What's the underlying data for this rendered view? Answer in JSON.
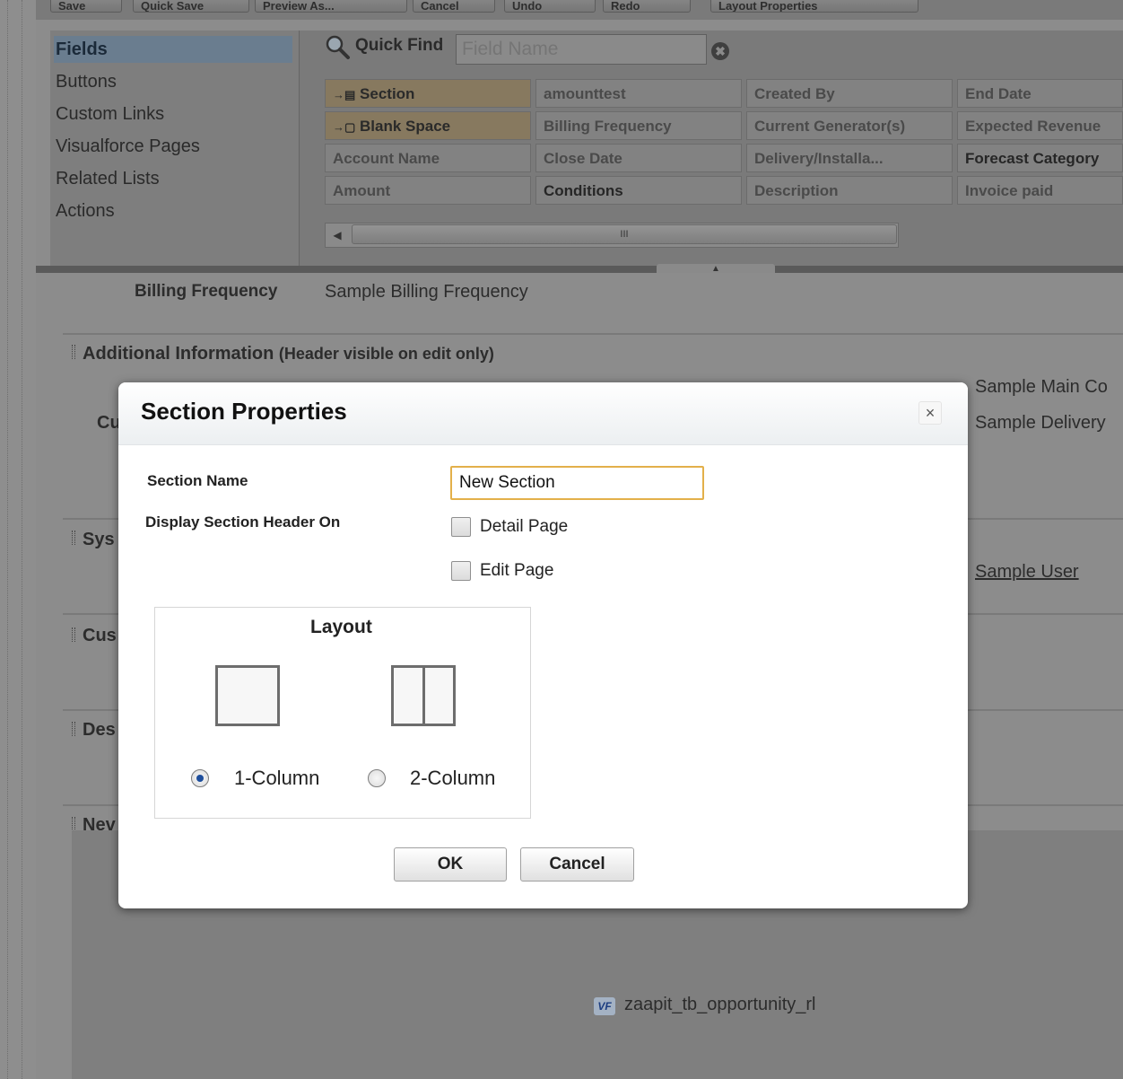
{
  "toolbar": {
    "buttons": [
      "Save",
      "Quick Save",
      "Preview As...",
      "Cancel",
      "Undo",
      "Redo",
      "Layout Properties"
    ]
  },
  "palette": {
    "nav": [
      "Fields",
      "Buttons",
      "Custom Links",
      "Visualforce Pages",
      "Related Lists",
      "Actions"
    ],
    "active_nav": "Fields",
    "quick_find_label": "Quick Find",
    "quick_find_placeholder": "Field Name",
    "fields": [
      [
        "Section",
        "amounttest",
        "Created By",
        "End Date"
      ],
      [
        "Blank Space",
        "Billing Frequency",
        "Current Generator(s)",
        "Expected Revenue"
      ],
      [
        "Account Name",
        "Close Date",
        "Delivery/Installa...",
        "Forecast Category"
      ],
      [
        "Amount",
        "Conditions",
        "Description",
        "Invoice paid"
      ]
    ],
    "scroll_thumb_text": "III"
  },
  "background": {
    "billing_label": "Billing Frequency",
    "billing_value": "Sample Billing Frequency",
    "additional_info_title": "Additional Information",
    "additional_info_note": "(Header visible on edit only)",
    "main_competitor_value": "Sample Main Co",
    "delivery_value": "Sample Delivery",
    "row2_prefix": "Cu",
    "system_section": "Sys",
    "custom_section": "Cus",
    "description_section": "Des",
    "new_section": "Nev",
    "sample_user": "Sample User",
    "vf_badge": "VF",
    "vf_page_name": "zaapit_tb_opportunity_rl"
  },
  "modal": {
    "title": "Section Properties",
    "close_label": "×",
    "section_name_label": "Section Name",
    "section_name_value": "New Section",
    "display_header_label": "Display Section Header On",
    "detail_page_label": "Detail Page",
    "edit_page_label": "Edit Page",
    "detail_page_checked": false,
    "edit_page_checked": false,
    "layout_title": "Layout",
    "one_column_label": "1-Column",
    "two_column_label": "2-Column",
    "selected_layout": "1-Column",
    "ok_label": "OK",
    "cancel_label": "Cancel"
  },
  "colors": {
    "overlay_gray": "#8c8c8c",
    "input_focus_border": "#e3b04a",
    "radio_selected": "#1e4e9c",
    "active_nav_bg": "#6a7d8f"
  }
}
